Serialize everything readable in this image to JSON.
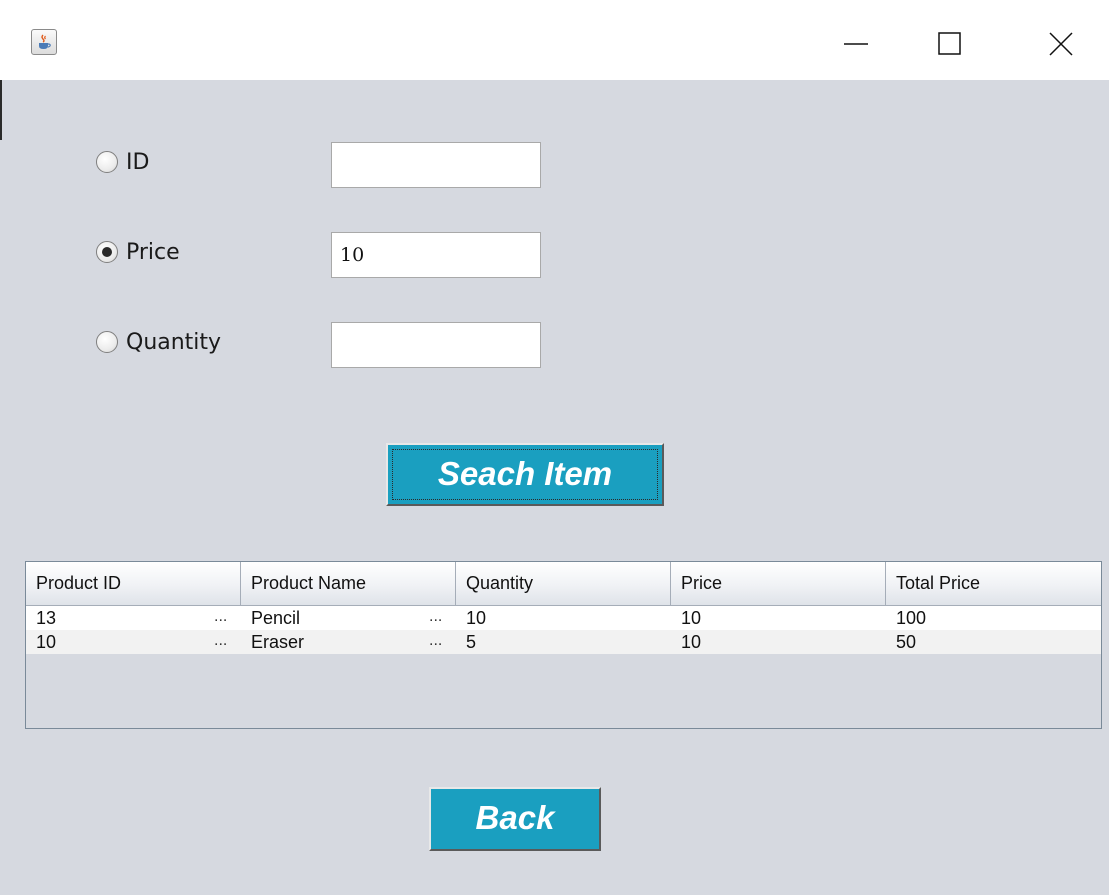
{
  "search": {
    "options": [
      {
        "label": "ID",
        "value": "",
        "checked": false
      },
      {
        "label": "Price",
        "value": "10",
        "checked": true
      },
      {
        "label": "Quantity",
        "value": "",
        "checked": false
      }
    ],
    "search_button_label": "Seach Item"
  },
  "table": {
    "columns": [
      "Product ID",
      "Product Name",
      "Quantity",
      "Price",
      "Total Price"
    ],
    "rows": [
      [
        "13",
        "Pencil",
        "10",
        "10",
        "100"
      ],
      [
        "10",
        "Eraser",
        "5",
        "10",
        "50"
      ]
    ],
    "truncation_marker": "..."
  },
  "footer": {
    "back_button_label": "Back"
  },
  "colors": {
    "button_bg": "#1a9fc0",
    "window_bg": "#d6d9e0"
  },
  "icons": {
    "app": "java-cup-icon",
    "minimize": "minimize-icon",
    "maximize": "maximize-icon",
    "close": "close-icon"
  }
}
